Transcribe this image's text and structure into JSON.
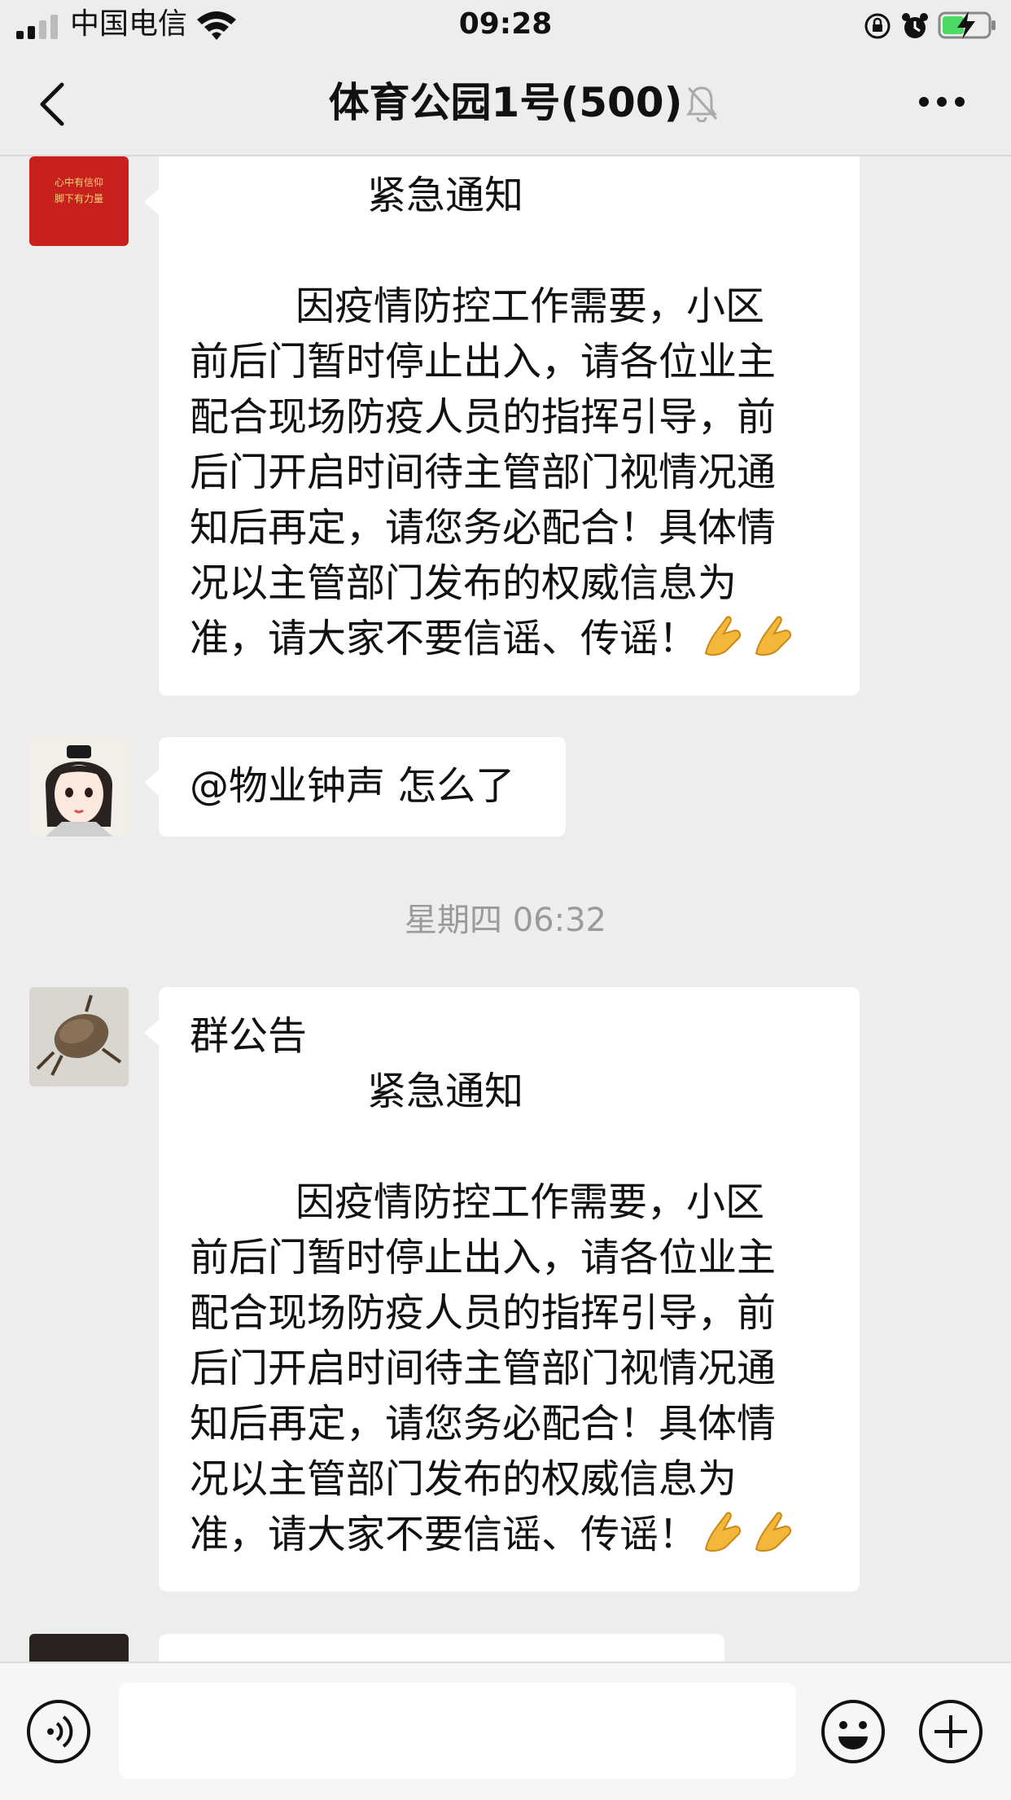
{
  "status_bar": {
    "carrier": "中国电信",
    "time": "09:28"
  },
  "nav": {
    "title": "体育公园1号(500)",
    "icons": [
      "back-chevron-icon",
      "mute-bell-icon",
      "more-icon"
    ]
  },
  "messages": [
    {
      "type": "notice",
      "avatar_text_1": "心中有信仰",
      "avatar_text_2": "脚下有力量",
      "heading": "紧急通知",
      "lines": [
        "因疫情防控工作需要，小区",
        "前后门暂时停止出入，请各位业主",
        "配合现场防疫人员的指挥引导，前",
        "后门开启时间待主管部门视情况通",
        "知后再定，请您务必配合！具体情",
        "况以主管部门发布的权威信息为",
        "准，请大家不要信谣、传谣！"
      ]
    },
    {
      "type": "text",
      "text": "@物业钟声 怎么了"
    },
    {
      "type": "notice",
      "label": "群公告",
      "heading": "紧急通知",
      "lines": [
        "因疫情防控工作需要，小区",
        "前后门暂时停止出入，请各位业主",
        "配合现场防疫人员的指挥引导，前",
        "后门开启时间待主管部门视情况通",
        "知后再定，请您务必配合！具体情",
        "况以主管部门发布的权威信息为",
        "准，请大家不要信谣、传谣！"
      ]
    }
  ],
  "timestamp": "星期四 06:32",
  "colors": {
    "background": "#ededed",
    "bubble": "#ffffff",
    "timestamp": "#9a9a9a",
    "avatar_red": "#c8201c"
  }
}
